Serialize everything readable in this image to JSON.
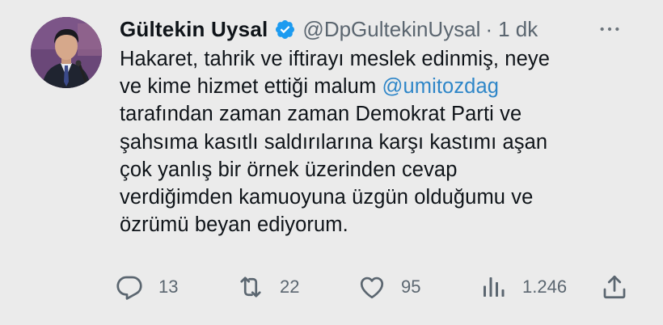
{
  "tweet": {
    "author_name": "Gültekin Uysal",
    "handle": "@DpGultekinUysal",
    "separator": "·",
    "time": "1 dk",
    "body_lines": [
      {
        "text": "Hakaret, tahrik ve iftirayı meslek edinmiş, neye",
        "mention": ""
      },
      {
        "text": "ve kime hizmet ettiği malum ",
        "mention": "@umitozdag"
      },
      {
        "text": "tarafından zaman zaman Demokrat Parti ve",
        "mention": ""
      },
      {
        "text": "şahsıma kasıtlı saldırılarına karşı kastımı aşan",
        "mention": ""
      },
      {
        "text": "çok yanlış bir örnek üzerinden cevap",
        "mention": ""
      },
      {
        "text": "verdiğimden kamuoyuna üzgün olduğumu ve",
        "mention": ""
      },
      {
        "text": "özrümü beyan ediyorum.",
        "mention": ""
      }
    ]
  },
  "actions": {
    "replies": "13",
    "retweets": "22",
    "likes": "95",
    "views": "1.246"
  },
  "icons": {
    "verified": "verified-badge-icon",
    "more": "more-icon",
    "reply": "reply-icon",
    "retweet": "retweet-icon",
    "like": "heart-icon",
    "views": "views-icon",
    "share": "share-icon"
  },
  "colors": {
    "background": "#ebebeb",
    "verified": "#1d9bf0",
    "mention": "#2e86c8",
    "secondary": "#5b6670"
  }
}
